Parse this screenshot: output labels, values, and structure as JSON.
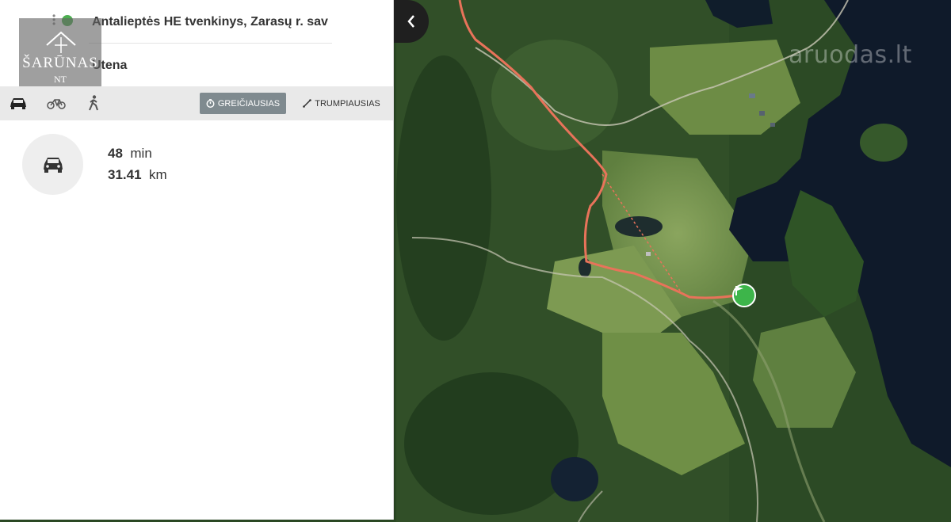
{
  "route": {
    "from": "Antalieptės HE tvenkinys, Zarasų r. sav",
    "to": "Utena"
  },
  "logo": {
    "brand": "ŠARŪNAS",
    "sub": "NT"
  },
  "modes": [
    {
      "name": "car",
      "icon": "car-icon",
      "active": true
    },
    {
      "name": "bike",
      "icon": "bike-icon",
      "active": false
    },
    {
      "name": "walk",
      "icon": "walk-icon",
      "active": false
    }
  ],
  "options": {
    "fastest": "GREIČIAUSIAS",
    "shortest": "TRUMPIAUSIAS"
  },
  "result": {
    "time_value": "48",
    "time_unit": "min",
    "dist_value": "31.41",
    "dist_unit": "km"
  },
  "map": {
    "watermark": "aruodas.lt"
  },
  "colors": {
    "accent": "#7f8a8f",
    "route": "#e8735a",
    "flag": "#3db54a"
  }
}
